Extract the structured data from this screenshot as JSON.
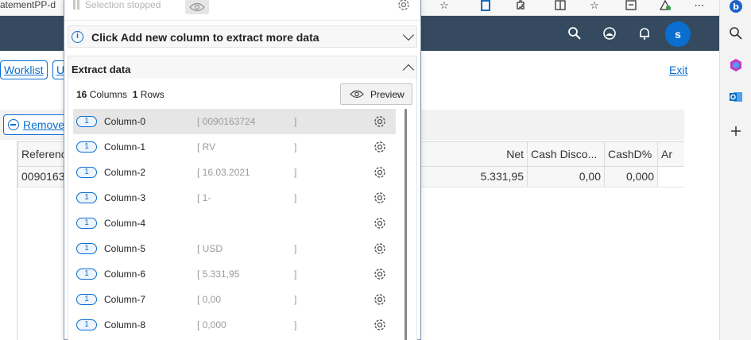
{
  "browser": {
    "tab_title": "atementPP-d",
    "icons": [
      "star-icon",
      "office-icon",
      "extension-icon",
      "split-screen-icon",
      "favorites-icon",
      "collections-icon",
      "performance-icon",
      "more-icon"
    ]
  },
  "edge_sidebar": {
    "items": [
      "copilot-icon",
      "search-icon",
      "m365-icon",
      "outlook-icon",
      "add-icon"
    ]
  },
  "shell": {
    "avatar_initial": "s",
    "icons": [
      "search-icon",
      "notification-status-icon",
      "bell-icon"
    ]
  },
  "page": {
    "worklist_label": "Worklist",
    "second_btn_label": "U",
    "exit_label": "Exit",
    "remove_label": "Remove",
    "grid": {
      "headers": [
        "Referenc",
        "Net",
        "Cash Disco...",
        "CashD%",
        "Ar"
      ],
      "row": [
        "0090163",
        "5.331,95",
        "0,00",
        "0,000",
        ""
      ]
    }
  },
  "extractor": {
    "status_text": "Selection stopped",
    "info_text": "Click Add new column to extract more data",
    "section_title": "Extract data",
    "columns_count": "16",
    "columns_label": "Columns",
    "rows_count": "1",
    "rows_label": "Rows",
    "preview_label": "Preview",
    "columns": [
      {
        "badge": "1",
        "name": "Column-0",
        "value": "[ 0090163724",
        "end": "]",
        "selected": true
      },
      {
        "badge": "1",
        "name": "Column-1",
        "value": "[ RV",
        "end": "]"
      },
      {
        "badge": "1",
        "name": "Column-2",
        "value": "[ 16.03.2021",
        "end": "]"
      },
      {
        "badge": "1",
        "name": "Column-3",
        "value": "[ 1-",
        "end": "]"
      },
      {
        "badge": "1",
        "name": "Column-4",
        "value": "",
        "end": ""
      },
      {
        "badge": "1",
        "name": "Column-5",
        "value": "[ USD",
        "end": "]"
      },
      {
        "badge": "1",
        "name": "Column-6",
        "value": "[ 5.331,95",
        "end": "]"
      },
      {
        "badge": "1",
        "name": "Column-7",
        "value": "[ 0,00",
        "end": "]"
      },
      {
        "badge": "1",
        "name": "Column-8",
        "value": "[ 0,000",
        "end": "]"
      }
    ]
  },
  "colors": {
    "shellbar": "#354a5f",
    "accent": "#0a6ed1",
    "panel_border": "#7f93a8"
  }
}
